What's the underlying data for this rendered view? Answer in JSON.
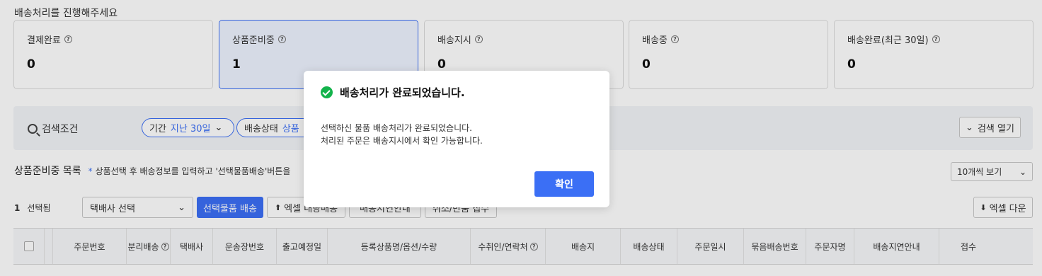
{
  "page": {
    "section_title": "배송처리를 진행해주세요"
  },
  "status_cards": [
    {
      "label": "결제완료",
      "value": "0"
    },
    {
      "label": "상품준비중",
      "value": "1"
    },
    {
      "label": "배송지시",
      "value": "0"
    },
    {
      "label": "배송중",
      "value": "0"
    },
    {
      "label": "배송완료(최근 30일)",
      "value": "0"
    }
  ],
  "search": {
    "label": "검색조건",
    "period_key": "기간",
    "period_value": "지난 30일",
    "status_key": "배송상태",
    "status_value": "상품",
    "open_label": "검색 열기"
  },
  "list": {
    "title": "상품준비중 목록",
    "desc": "상품선택 후 배송정보를 입력하고 '선택물품배송'버튼을",
    "per_page": "10개씩 보기"
  },
  "toolbar": {
    "selected_count": "1",
    "selected_label": "선택됨",
    "carrier_placeholder": "택배사 선택",
    "ship_selected": "선택물품 배송",
    "excel_ship": "엑셀 대량배송",
    "delay_guide": "배송지연안내",
    "cancel_request": "취소/반품 접수",
    "excel_download": "엑셀 다운"
  },
  "table_headers": [
    "주문번호",
    "분리배송",
    "택배사",
    "운송장번호",
    "출고예정일",
    "등록상품명/옵션/수량",
    "수취인/연락처",
    "배송지",
    "배송상태",
    "주문일시",
    "묶음배송번호",
    "주문자명",
    "배송지연안내",
    "접수"
  ],
  "modal": {
    "title": "배송처리가 완료되었습니다.",
    "line1": "선택하신 물품 배송처리가 완료되었습니다.",
    "line2": "처리된 주문은 배송지시에서 확인 가능합니다.",
    "confirm": "확인"
  },
  "colors": {
    "accent": "#3b6ff5",
    "success": "#13b34b"
  }
}
